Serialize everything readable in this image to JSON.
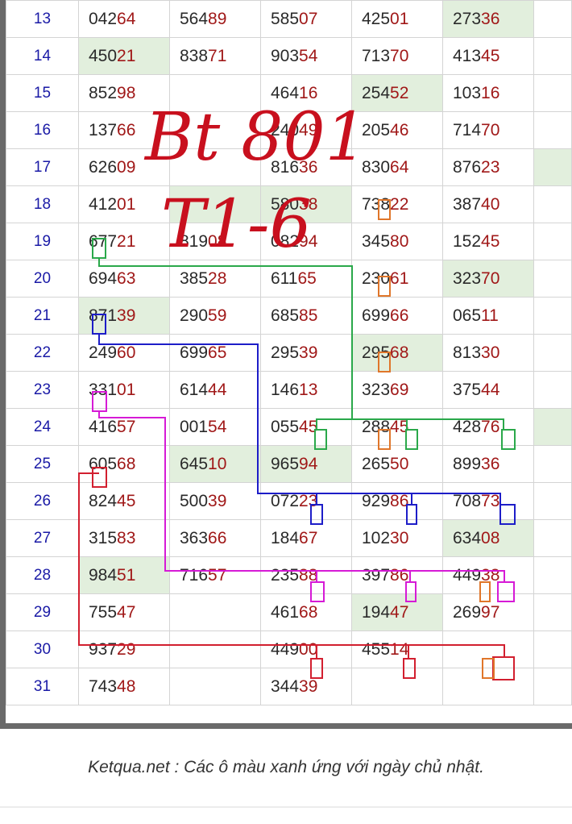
{
  "table": {
    "rows": [
      {
        "day": "13",
        "cells": [
          {
            "head": "042",
            "tail": "64",
            "sunday": false
          },
          {
            "head": "564",
            "tail": "89",
            "sunday": false
          },
          {
            "head": "585",
            "tail": "07",
            "sunday": false
          },
          {
            "head": "425",
            "tail": "01",
            "sunday": false
          },
          {
            "head": "273",
            "tail": "36",
            "sunday": true
          }
        ],
        "tail_sunday": false
      },
      {
        "day": "14",
        "cells": [
          {
            "head": "450",
            "tail": "21",
            "sunday": true
          },
          {
            "head": "838",
            "tail": "71",
            "sunday": false
          },
          {
            "head": "903",
            "tail": "54",
            "sunday": false
          },
          {
            "head": "713",
            "tail": "70",
            "sunday": false
          },
          {
            "head": "413",
            "tail": "45",
            "sunday": false
          }
        ],
        "tail_sunday": false
      },
      {
        "day": "15",
        "cells": [
          {
            "head": "852",
            "tail": "98",
            "sunday": false
          },
          {
            "head": "",
            "tail": "",
            "sunday": false
          },
          {
            "head": "464",
            "tail": "16",
            "sunday": false
          },
          {
            "head": "254",
            "tail": "52",
            "sunday": true
          },
          {
            "head": "103",
            "tail": "16",
            "sunday": false
          }
        ],
        "tail_sunday": false
      },
      {
        "day": "16",
        "cells": [
          {
            "head": "137",
            "tail": "66",
            "sunday": false
          },
          {
            "head": "",
            "tail": "",
            "sunday": false
          },
          {
            "head": "240",
            "tail": "49",
            "sunday": false
          },
          {
            "head": "205",
            "tail": "46",
            "sunday": false
          },
          {
            "head": "714",
            "tail": "70",
            "sunday": false
          }
        ],
        "tail_sunday": false
      },
      {
        "day": "17",
        "cells": [
          {
            "head": "626",
            "tail": "09",
            "sunday": false
          },
          {
            "head": "",
            "tail": "",
            "sunday": false
          },
          {
            "head": "816",
            "tail": "36",
            "sunday": false
          },
          {
            "head": "830",
            "tail": "64",
            "sunday": false
          },
          {
            "head": "876",
            "tail": "23",
            "sunday": false
          }
        ],
        "tail_sunday": true
      },
      {
        "day": "18",
        "cells": [
          {
            "head": "412",
            "tail": "01",
            "sunday": false
          },
          {
            "head": "",
            "tail": "",
            "sunday": true
          },
          {
            "head": "580",
            "tail": "38",
            "sunday": true
          },
          {
            "head": "738",
            "tail": "22",
            "sunday": false
          },
          {
            "head": "387",
            "tail": "40",
            "sunday": false
          }
        ],
        "tail_sunday": false
      },
      {
        "day": "19",
        "cells": [
          {
            "head": "677",
            "tail": "21",
            "sunday": false
          },
          {
            "head": "819",
            "tail": "08",
            "sunday": false
          },
          {
            "head": "082",
            "tail": "94",
            "sunday": false
          },
          {
            "head": "345",
            "tail": "80",
            "sunday": false
          },
          {
            "head": "152",
            "tail": "45",
            "sunday": false
          }
        ],
        "tail_sunday": false
      },
      {
        "day": "20",
        "cells": [
          {
            "head": "694",
            "tail": "63",
            "sunday": false
          },
          {
            "head": "385",
            "tail": "28",
            "sunday": false
          },
          {
            "head": "611",
            "tail": "65",
            "sunday": false
          },
          {
            "head": "230",
            "tail": "61",
            "sunday": false
          },
          {
            "head": "323",
            "tail": "70",
            "sunday": true
          }
        ],
        "tail_sunday": false
      },
      {
        "day": "21",
        "cells": [
          {
            "head": "871",
            "tail": "39",
            "sunday": true
          },
          {
            "head": "290",
            "tail": "59",
            "sunday": false
          },
          {
            "head": "685",
            "tail": "85",
            "sunday": false
          },
          {
            "head": "699",
            "tail": "66",
            "sunday": false
          },
          {
            "head": "065",
            "tail": "11",
            "sunday": false
          }
        ],
        "tail_sunday": false
      },
      {
        "day": "22",
        "cells": [
          {
            "head": "249",
            "tail": "60",
            "sunday": false
          },
          {
            "head": "699",
            "tail": "65",
            "sunday": false
          },
          {
            "head": "295",
            "tail": "39",
            "sunday": false
          },
          {
            "head": "295",
            "tail": "68",
            "sunday": true
          },
          {
            "head": "813",
            "tail": "30",
            "sunday": false
          }
        ],
        "tail_sunday": false
      },
      {
        "day": "23",
        "cells": [
          {
            "head": "331",
            "tail": "01",
            "sunday": false
          },
          {
            "head": "614",
            "tail": "44",
            "sunday": false
          },
          {
            "head": "146",
            "tail": "13",
            "sunday": false
          },
          {
            "head": "323",
            "tail": "69",
            "sunday": false
          },
          {
            "head": "375",
            "tail": "44",
            "sunday": false
          }
        ],
        "tail_sunday": false
      },
      {
        "day": "24",
        "cells": [
          {
            "head": "416",
            "tail": "57",
            "sunday": false
          },
          {
            "head": "001",
            "tail": "54",
            "sunday": false
          },
          {
            "head": "055",
            "tail": "45",
            "sunday": false
          },
          {
            "head": "288",
            "tail": "45",
            "sunday": false
          },
          {
            "head": "428",
            "tail": "76",
            "sunday": false
          }
        ],
        "tail_sunday": true
      },
      {
        "day": "25",
        "cells": [
          {
            "head": "605",
            "tail": "68",
            "sunday": false
          },
          {
            "head": "645",
            "tail": "10",
            "sunday": true
          },
          {
            "head": "965",
            "tail": "94",
            "sunday": true
          },
          {
            "head": "265",
            "tail": "50",
            "sunday": false
          },
          {
            "head": "899",
            "tail": "36",
            "sunday": false
          }
        ],
        "tail_sunday": false
      },
      {
        "day": "26",
        "cells": [
          {
            "head": "824",
            "tail": "45",
            "sunday": false
          },
          {
            "head": "500",
            "tail": "39",
            "sunday": false
          },
          {
            "head": "072",
            "tail": "23",
            "sunday": false
          },
          {
            "head": "929",
            "tail": "86",
            "sunday": false
          },
          {
            "head": "708",
            "tail": "73",
            "sunday": false
          }
        ],
        "tail_sunday": false
      },
      {
        "day": "27",
        "cells": [
          {
            "head": "315",
            "tail": "83",
            "sunday": false
          },
          {
            "head": "363",
            "tail": "66",
            "sunday": false
          },
          {
            "head": "184",
            "tail": "67",
            "sunday": false
          },
          {
            "head": "102",
            "tail": "30",
            "sunday": false
          },
          {
            "head": "634",
            "tail": "08",
            "sunday": true
          }
        ],
        "tail_sunday": false
      },
      {
        "day": "28",
        "cells": [
          {
            "head": "984",
            "tail": "51",
            "sunday": true
          },
          {
            "head": "716",
            "tail": "57",
            "sunday": false
          },
          {
            "head": "235",
            "tail": "88",
            "sunday": false
          },
          {
            "head": "397",
            "tail": "86",
            "sunday": false
          },
          {
            "head": "449",
            "tail": "38",
            "sunday": false
          }
        ],
        "tail_sunday": false
      },
      {
        "day": "29",
        "cells": [
          {
            "head": "755",
            "tail": "47",
            "sunday": false
          },
          {
            "head": "",
            "tail": "",
            "sunday": false
          },
          {
            "head": "461",
            "tail": "68",
            "sunday": false
          },
          {
            "head": "194",
            "tail": "47",
            "sunday": true
          },
          {
            "head": "269",
            "tail": "97",
            "sunday": false
          }
        ],
        "tail_sunday": false
      },
      {
        "day": "30",
        "cells": [
          {
            "head": "937",
            "tail": "29",
            "sunday": false
          },
          {
            "head": "",
            "tail": "",
            "sunday": false
          },
          {
            "head": "449",
            "tail": "00",
            "sunday": false
          },
          {
            "head": "455",
            "tail": "14",
            "sunday": false
          },
          {
            "head": "",
            "tail": "",
            "sunday": false
          }
        ],
        "tail_sunday": false
      },
      {
        "day": "31",
        "cells": [
          {
            "head": "743",
            "tail": "48",
            "sunday": false
          },
          {
            "head": "",
            "tail": "",
            "sunday": false
          },
          {
            "head": "344",
            "tail": "39",
            "sunday": false
          },
          {
            "head": "",
            "tail": "",
            "sunday": false
          },
          {
            "head": "",
            "tail": "",
            "sunday": false
          }
        ],
        "tail_sunday": false
      }
    ]
  },
  "handwriting": {
    "line1": "Bt 801",
    "line2": "T1-6",
    "color": "#c8101e"
  },
  "colors": {
    "sunday_fill": "#e2efdd",
    "day_text": "#1a1aa6",
    "tail_text": "#a01818",
    "line_green": "#2aa84a",
    "line_blue": "#1d1dc8",
    "line_magenta": "#d61ad6",
    "line_red": "#d21f2f"
  },
  "footer": {
    "note": "Ketqua.net : Các ô màu xanh ứng với ngày chủ nhật."
  }
}
